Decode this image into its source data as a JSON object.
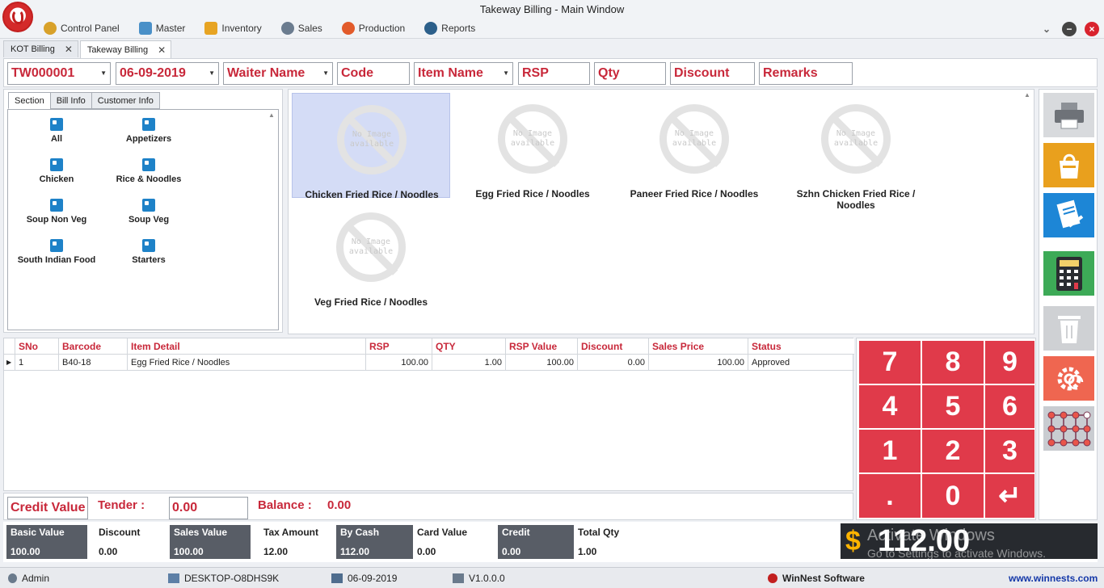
{
  "window": {
    "title": "Takeway Billing - Main Window"
  },
  "menu": [
    {
      "label": "Control Panel",
      "icon": "control-panel-icon",
      "color": "#d8a12a"
    },
    {
      "label": "Master",
      "icon": "master-icon",
      "color": "#4a90c8"
    },
    {
      "label": "Inventory",
      "icon": "inventory-icon",
      "color": "#e7a423"
    },
    {
      "label": "Sales",
      "icon": "sales-icon",
      "color": "#6b7c8f"
    },
    {
      "label": "Production",
      "icon": "production-icon",
      "color": "#e25b2b"
    },
    {
      "label": "Reports",
      "icon": "reports-icon",
      "color": "#2c5f8a"
    }
  ],
  "doc_tabs": [
    {
      "label": "KOT Billing",
      "active": false
    },
    {
      "label": "Takeway Billing",
      "active": true
    }
  ],
  "entry": {
    "bill_no": "TW000001",
    "date": "06-09-2019",
    "waiter_placeholder": "Waiter Name",
    "code_placeholder": "Code",
    "item_name_placeholder": "Item Name",
    "rsp_placeholder": "RSP",
    "qty_placeholder": "Qty",
    "discount_placeholder": "Discount",
    "remarks_placeholder": "Remarks"
  },
  "section_tabs": [
    "Section",
    "Bill Info",
    "Customer Info"
  ],
  "sections": [
    "All",
    "Appetizers",
    "Chicken",
    "Rice & Noodles",
    "Soup Non Veg",
    "Soup Veg",
    "South Indian Food",
    "Starters"
  ],
  "no_image": {
    "line1": "No Image",
    "line2": "available"
  },
  "items": [
    {
      "name": "Chicken Fried Rice / Noodles",
      "selected": true
    },
    {
      "name": "Egg Fried Rice / Noodles",
      "selected": false
    },
    {
      "name": "Paneer Fried Rice / Noodles",
      "selected": false
    },
    {
      "name": "Szhn Chicken Fried Rice / Noodles",
      "selected": false
    },
    {
      "name": "Veg Fried Rice / Noodles",
      "selected": false
    }
  ],
  "table": {
    "columns": [
      "SNo",
      "Barcode",
      "Item Detail",
      "RSP",
      "QTY",
      "RSP Value",
      "Discount",
      "Sales Price",
      "Status"
    ],
    "rows": [
      [
        "1",
        "B40-18",
        "Egg Fried Rice / Noodles",
        "100.00",
        "1.00",
        "100.00",
        "0.00",
        "100.00",
        "Approved"
      ]
    ]
  },
  "tender": {
    "credit_label": "Credit Value",
    "tender_label": "Tender :",
    "tender_value": "0.00",
    "balance_label": "Balance :",
    "balance_value": "0.00"
  },
  "keypad": [
    "7",
    "8",
    "9",
    "4",
    "5",
    "6",
    "1",
    "2",
    "3",
    ".",
    "0",
    "↵"
  ],
  "summary": [
    {
      "label": "Basic Value",
      "value": "100.00",
      "style": "dark"
    },
    {
      "label": "Discount",
      "value": "0.00",
      "style": "light"
    },
    {
      "label": "Sales Value",
      "value": "100.00",
      "style": "dark"
    },
    {
      "label": "Tax Amount",
      "value": "12.00",
      "style": "light"
    },
    {
      "label": "By Cash",
      "value": "112.00",
      "style": "dark"
    },
    {
      "label": "Card Value",
      "value": "0.00",
      "style": "light"
    },
    {
      "label": "Credit",
      "value": "0.00",
      "style": "dark"
    },
    {
      "label": "Total  Qty",
      "value": "1.00",
      "style": "light"
    }
  ],
  "total": {
    "currency": "$",
    "value": "112.00"
  },
  "watermark": {
    "line1": "Activate Windows",
    "line2": "Go to Settings to activate Windows."
  },
  "actions": [
    {
      "name": "print-icon",
      "bg": "#d8dadd"
    },
    {
      "name": "takeaway-bag-icon",
      "bg": "#e9a01d"
    },
    {
      "name": "credit-card-icon",
      "bg": "#1d86d6"
    },
    {
      "name": "calculator-icon",
      "bg": "#3daa57"
    },
    {
      "name": "trash-icon",
      "bg": "#cfd1d4"
    },
    {
      "name": "settings-refresh-icon",
      "bg": "#ef6650"
    },
    {
      "name": "network-grid-icon",
      "bg": "#c9ccd1"
    }
  ],
  "status": {
    "user": "Admin",
    "machine": "DESKTOP-O8DHS9K",
    "date": "06-09-2019",
    "version": "V1.0.0.0",
    "brand": "WinNest Software",
    "website": "www.winnests.com"
  }
}
